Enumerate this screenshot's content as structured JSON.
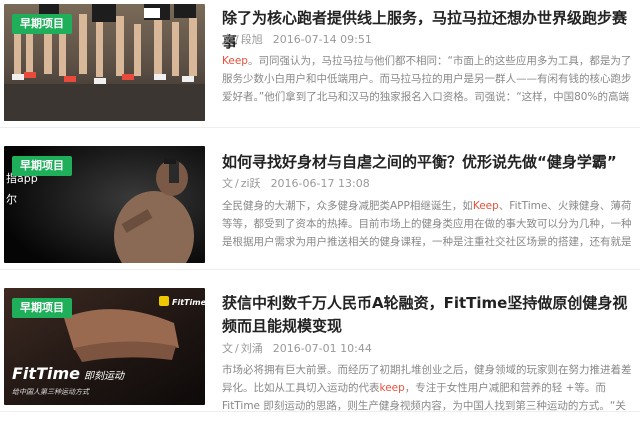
{
  "articles": [
    {
      "tag": "早期项目",
      "title": "除了为核心跑者提供线上服务，马拉马拉还想办世界级跑步赛事",
      "category": "文",
      "author": "段旭",
      "date": "2016-07-14 09:51",
      "summary_kw": "Keep",
      "summary_rest": "。司同强认为，马拉马拉与他们都不相同：“市面上的这些应用多为工具，都是为了服务少数小白用户和中低端用户。而马拉马拉的用户是另一群人——有闲有钱的核心跑步爱好者。”他们拿到了北马和汉马的独家报名入口资格。司强说：“这样，中国80%的高端核心…"
    },
    {
      "tag": "早期项目",
      "title": "如何寻找好身材与自虐之间的平衡？优形说先做“健身学霸”",
      "category": "文",
      "author": "zi跃",
      "date": "2016-06-17 13:08",
      "summary_pre": "全民健身的大潮下，众多健身减肥类APP相继诞生，如",
      "summary_kw": "Keep",
      "summary_rest": "、FitTime、火辣健身、薄荷等等，都受到了资本的热捧。目前市场上的健身类应用在做的事大致可以分为几种，一种是根据用户需求为用户推送相关的健身课程，一种是注重社交社区场景的搭建，还有就是在线上…",
      "thumb_text_1": "指app",
      "thumb_text_2": "尔"
    },
    {
      "tag": "早期项目",
      "title": "获信中利数千万人民币A轮融资，FitTime坚持做原创健身视频而且能规模变现",
      "category": "文",
      "author": "刘涌",
      "date": "2016-07-01 10:44",
      "summary_pre": "市场必将拥有巨大前景。而经历了初期扎堆创业之后，健身领域的玩家则在努力推进着差异化。比如从工具切入运动的代表",
      "summary_kw": "keep",
      "summary_rest": "，专注于女性用户减肥和营养的轻 +等。而FitTime 即刻运动的思路，则生产健身视频内容，为中国人找到第三种运动的方式。“关于运动一般会…",
      "thumb_brand": "FitTime",
      "thumb_brand_cn": "即刻运动",
      "thumb_slogan": "给中国人第三种运动方式",
      "thumb_logo": "FitTime"
    }
  ],
  "colors": {
    "tag_bg": "#1fae5a",
    "keyword": "#e5503b"
  }
}
